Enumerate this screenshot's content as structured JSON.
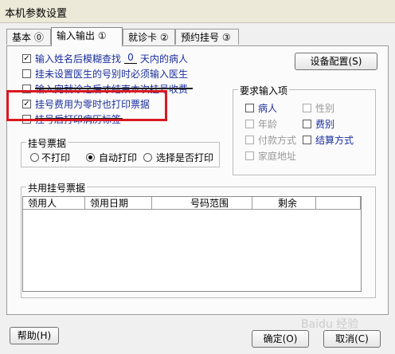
{
  "window": {
    "title": "本机参数设置"
  },
  "tabs": [
    {
      "label": "基本 ⓪"
    },
    {
      "label": "输入输出 ①"
    },
    {
      "label": "就诊卡 ②"
    },
    {
      "label": "预约挂号 ③"
    }
  ],
  "io": {
    "fuzzy_prefix": "输入姓名后模糊查找",
    "fuzzy_days": "0",
    "fuzzy_suffix": "天内的病人",
    "opt_must_input_doctor": "挂未设置医生的号别时必须输入医生",
    "opt_strike_text": "输入完就诊之后才结束本次挂号收费",
    "opt_print_zero_fee": "挂号费用为零时也打印票据",
    "opt_print_case_label": "挂号后打印病历标签",
    "device_button": "设备配置(S)"
  },
  "receipt": {
    "title": "挂号票据",
    "options": [
      "不打印",
      "自动打印",
      "选择是否打印"
    ],
    "selected": "自动打印"
  },
  "required_inputs": {
    "title": "要求输入项",
    "items": [
      {
        "label": "病人",
        "enabled": true,
        "checked": false
      },
      {
        "label": "性别",
        "enabled": false,
        "checked": false
      },
      {
        "label": "年龄",
        "enabled": false,
        "checked": false
      },
      {
        "label": "费别",
        "enabled": true,
        "checked": false
      },
      {
        "label": "付款方式",
        "enabled": false,
        "checked": false
      },
      {
        "label": "结算方式",
        "enabled": true,
        "checked": false
      },
      {
        "label": "家庭地址",
        "enabled": false,
        "checked": false
      }
    ]
  },
  "shared_receipt": {
    "title": "共用挂号票据",
    "columns": [
      "领用人",
      "领用日期",
      "号码范围",
      "剩余"
    ]
  },
  "footer": {
    "help": "帮助(H)",
    "ok": "确定(O)",
    "cancel": "取消(C)"
  },
  "watermark": "Baidu 经验"
}
